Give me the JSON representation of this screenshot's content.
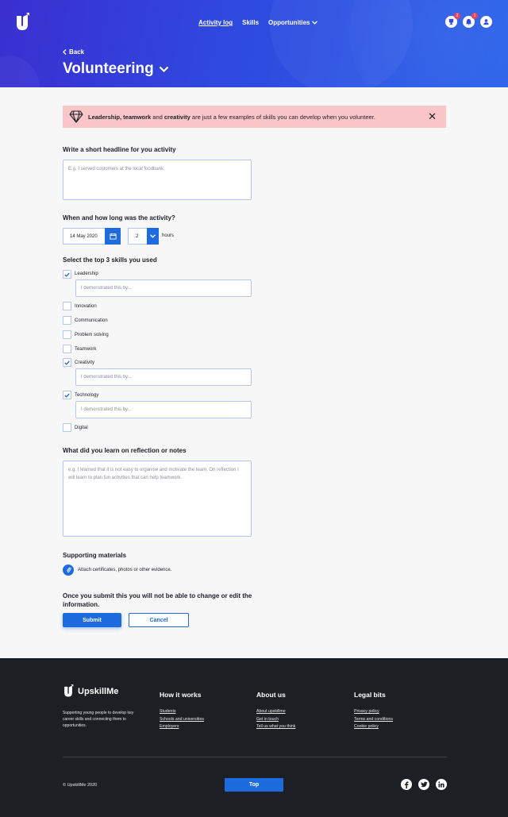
{
  "nav": {
    "items": [
      {
        "label": "Activity log"
      },
      {
        "label": "Skills"
      },
      {
        "label": "Opportunities"
      }
    ]
  },
  "header_icons": {
    "rewards_badge": "2",
    "notifications_badge": "1"
  },
  "page": {
    "back_label": "Back",
    "title": "Volunteering"
  },
  "alert": {
    "bold1": "Leadership, teamwork",
    "and": " and ",
    "bold2": "creativity",
    "rest": " are just a few examples of skills you can develop when you volunteer."
  },
  "headline": {
    "label": "Write a short headline for you activity",
    "placeholder": "E.g. I served customers at the local foodbank"
  },
  "when": {
    "label": "When and how long was the activity?",
    "date": "14 May 2020",
    "hours_value": "2",
    "hours_label": "hours"
  },
  "skills": {
    "label": "Select the top 3 skills you used",
    "demo_placeholder": "I demonstrated this by...",
    "items": [
      {
        "name": "Leadership",
        "checked": true
      },
      {
        "name": "Innovation",
        "checked": false
      },
      {
        "name": "Communication",
        "checked": false
      },
      {
        "name": "Problem solving",
        "checked": false
      },
      {
        "name": "Teamwork",
        "checked": false
      },
      {
        "name": "Creativity",
        "checked": true
      },
      {
        "name": "Technology",
        "checked": true
      },
      {
        "name": "Digital",
        "checked": false
      }
    ]
  },
  "reflection": {
    "label": "What did you learn on reflection or notes",
    "placeholder": "e.g. I learned that it is not easy to organise and motivate the team. On reflection I will learn to plan fun activities that can help teamwork."
  },
  "supporting": {
    "label": "Supporting materials",
    "attach_label": "Attach certificates, photos or other evidence."
  },
  "submit_warning": "Once you submit this you will not be able to change or edit the information.",
  "buttons": {
    "submit": "Submit",
    "cancel": "Cancel"
  },
  "footer": {
    "brand": "UpskillMe",
    "tagline": "Supporting young people to develop key career skills and connecting them to opportunities.",
    "col1": {
      "title": "How it works",
      "links": [
        "Students",
        "Schools and universities",
        "Employers"
      ]
    },
    "col2": {
      "title": "About us",
      "links": [
        "About upskillme",
        "Get in touch",
        "Tell us what you think"
      ]
    },
    "col3": {
      "title": "Legal bits",
      "links": [
        "Privacy policy",
        "Terms and conditions",
        "Cookie policy"
      ]
    },
    "copyright": "© UpskillMe 2020",
    "top_label": "Top"
  },
  "colors": {
    "primary": "#1e6bdf",
    "hero_start": "#3a2fd0",
    "hero_end": "#2a63ea",
    "alert_bg": "#fac6ca",
    "footer_bg": "#1c1f24"
  }
}
